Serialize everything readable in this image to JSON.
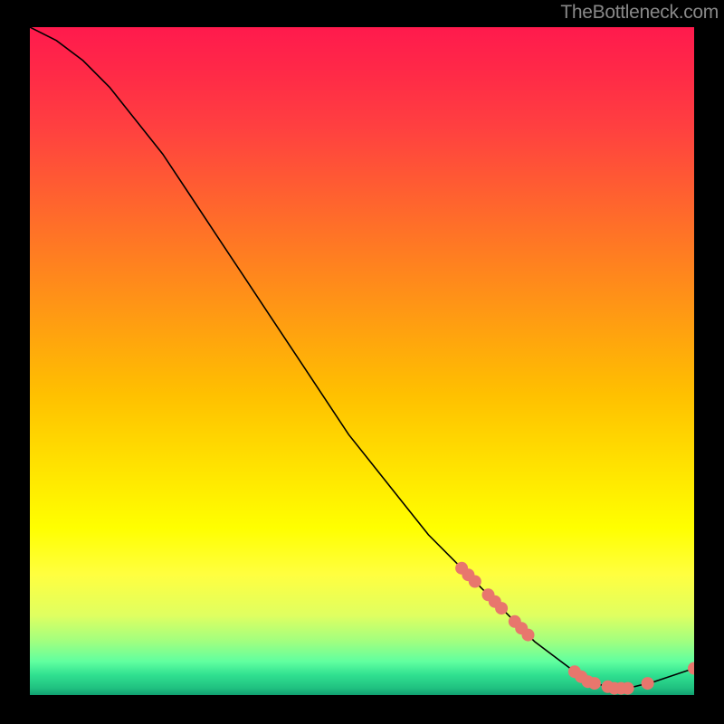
{
  "watermark": "TheBottleneck.com",
  "chart_data": {
    "type": "line",
    "title": "",
    "xlabel": "",
    "ylabel": "",
    "xlim": [
      0,
      100
    ],
    "ylim": [
      0,
      100
    ],
    "series": [
      {
        "name": "curve",
        "x": [
          0,
          4,
          8,
          12,
          16,
          20,
          24,
          28,
          32,
          36,
          40,
          44,
          48,
          52,
          56,
          60,
          64,
          68,
          72,
          76,
          80,
          84,
          88,
          90,
          94,
          100
        ],
        "values": [
          100,
          98,
          95,
          91,
          86,
          81,
          75,
          69,
          63,
          57,
          51,
          45,
          39,
          34,
          29,
          24,
          20,
          16,
          12,
          8,
          5,
          2,
          1,
          1,
          2,
          4
        ]
      }
    ],
    "marker_clusters_x": [
      [
        65,
        66,
        67,
        69,
        70,
        71,
        73,
        74,
        75
      ],
      [
        82,
        83,
        84,
        85,
        87,
        88,
        89,
        90,
        93
      ]
    ],
    "marker_color": "#e8766d",
    "marker_radius_px": 7,
    "end_marker": {
      "x": 100,
      "y": 4
    }
  }
}
